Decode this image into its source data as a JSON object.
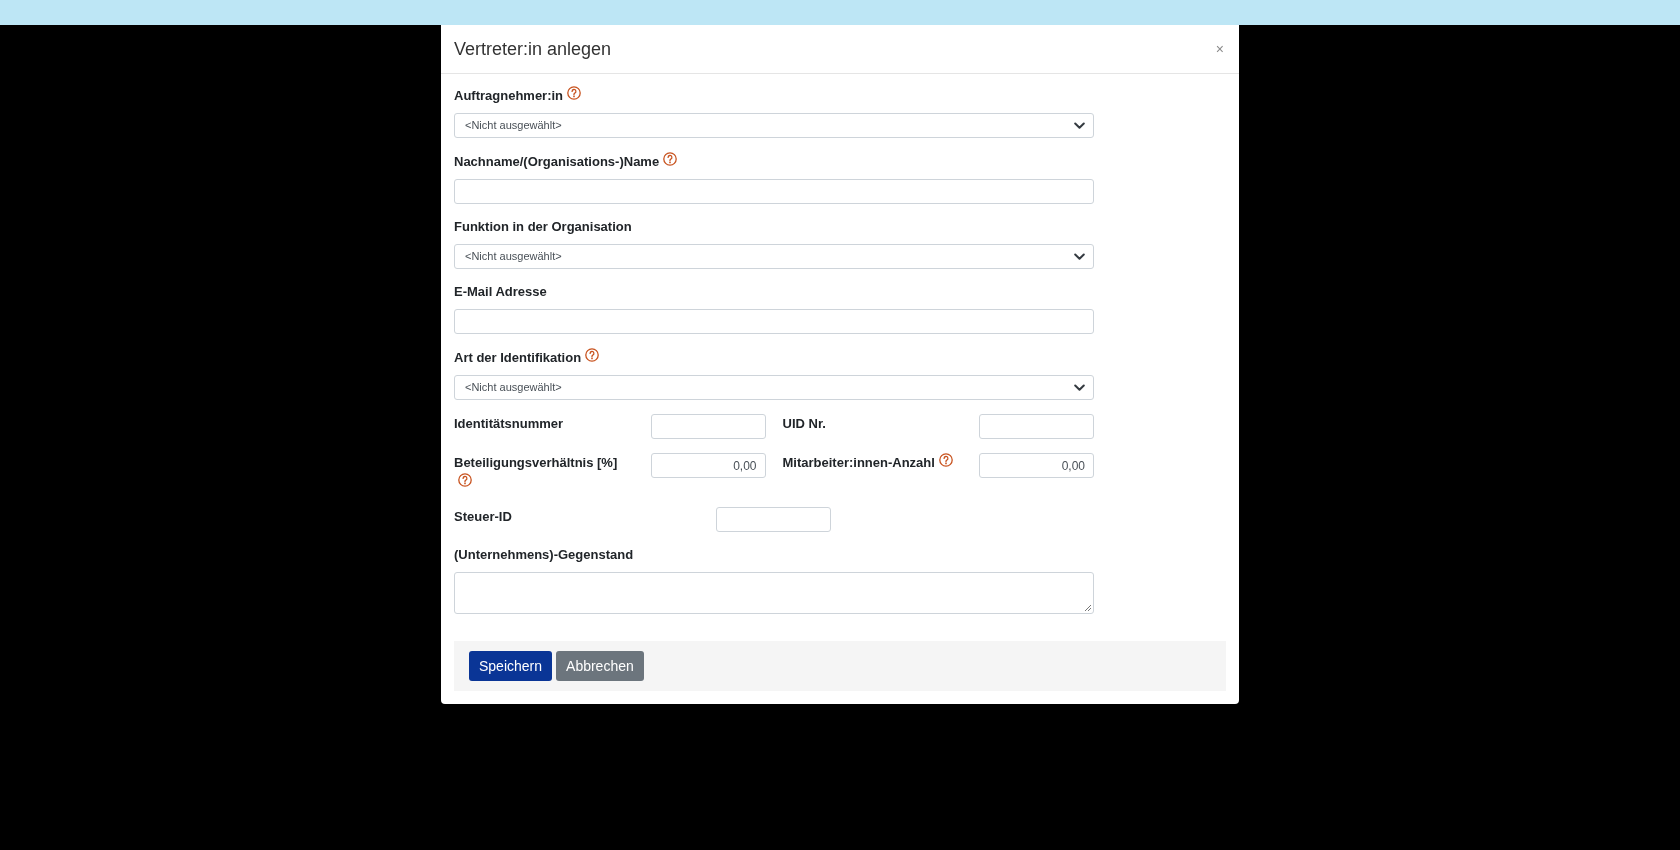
{
  "dialog": {
    "title": "Vertreter:in anlegen",
    "close_label": "×"
  },
  "form": {
    "rows": [
      {
        "kind": "select",
        "label": "Auftragnehmer:in",
        "help": true,
        "value": "<Nicht ausgewählt>"
      },
      {
        "kind": "text",
        "label": "Nachname/(Organisations-)Name",
        "help": true
      },
      {
        "kind": "select",
        "label": "Funktion in der Organisation",
        "help": false,
        "value": "<Nicht ausgewählt>"
      },
      {
        "kind": "text",
        "label": "E-Mail Adresse",
        "help": false
      },
      {
        "kind": "select",
        "label": "Art der Identifikation",
        "help": true,
        "value": "<Nicht ausgewählt>"
      },
      {
        "kind": "pair",
        "items": [
          {
            "label": "Identitätsnummer",
            "help": false
          },
          {
            "label": "UID Nr.",
            "help": false
          }
        ]
      },
      {
        "kind": "pair",
        "items": [
          {
            "label": "Beteiligungsverhältnis [%]",
            "help": true,
            "value": "0,00"
          },
          {
            "label": "Mitarbeiter:innen-Anzahl",
            "help": true,
            "value": "0,00"
          }
        ]
      },
      {
        "kind": "short",
        "label": "Steuer-ID",
        "help": false
      },
      {
        "kind": "textarea",
        "label": "(Unternehmens)-Gegenstand",
        "help": false
      }
    ]
  },
  "footer": {
    "buttons": [
      {
        "label": "Speichern",
        "kind": "primary"
      },
      {
        "label": "Abbrechen",
        "kind": "secondary"
      }
    ]
  }
}
